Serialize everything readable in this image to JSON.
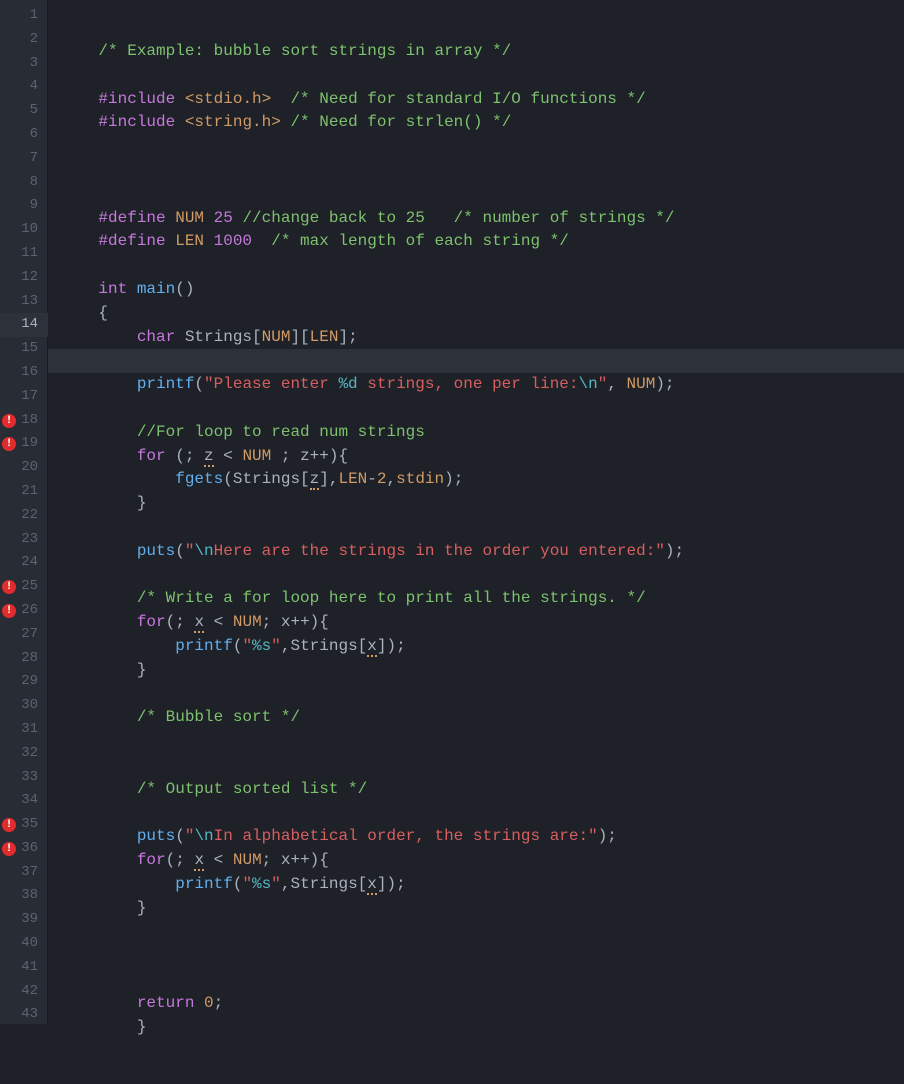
{
  "editor": {
    "currentLine": 14,
    "errorLines": [
      18,
      19,
      25,
      26,
      35,
      36
    ],
    "errorBadge": "!",
    "lines": [
      {
        "n": 1,
        "tokens": [
          [
            "    ",
            ""
          ],
          [
            "/* Example: bubble sort strings in array */",
            "c-comment"
          ]
        ]
      },
      {
        "n": 2,
        "tokens": []
      },
      {
        "n": 3,
        "tokens": [
          [
            "    ",
            ""
          ],
          [
            "#include ",
            "c-preproc"
          ],
          [
            "<stdio.h>",
            "c-include"
          ],
          [
            "  ",
            ""
          ],
          [
            "/* Need for standard I/O functions */",
            "c-comment"
          ]
        ]
      },
      {
        "n": 4,
        "tokens": [
          [
            "    ",
            ""
          ],
          [
            "#include ",
            "c-preproc"
          ],
          [
            "<string.h>",
            "c-include"
          ],
          [
            " ",
            ""
          ],
          [
            "/* Need for strlen() */",
            "c-comment"
          ]
        ]
      },
      {
        "n": 5,
        "tokens": []
      },
      {
        "n": 6,
        "tokens": []
      },
      {
        "n": 7,
        "tokens": []
      },
      {
        "n": 8,
        "tokens": [
          [
            "    ",
            ""
          ],
          [
            "#define ",
            "c-preproc"
          ],
          [
            "NUM ",
            "c-const"
          ],
          [
            "25",
            "c-number"
          ],
          [
            " ",
            ""
          ],
          [
            "//change back to 25   /* number of strings */",
            "c-comment"
          ]
        ]
      },
      {
        "n": 9,
        "tokens": [
          [
            "    ",
            ""
          ],
          [
            "#define ",
            "c-preproc"
          ],
          [
            "LEN ",
            "c-const"
          ],
          [
            "1000",
            "c-number"
          ],
          [
            "  ",
            ""
          ],
          [
            "/* max length of each string */",
            "c-comment"
          ]
        ]
      },
      {
        "n": 10,
        "tokens": []
      },
      {
        "n": 11,
        "tokens": [
          [
            "    ",
            ""
          ],
          [
            "int",
            "c-keyword"
          ],
          [
            " ",
            ""
          ],
          [
            "main",
            "c-func"
          ],
          [
            "()",
            "c-punct"
          ]
        ]
      },
      {
        "n": 12,
        "tokens": [
          [
            "    {",
            "c-punct"
          ]
        ]
      },
      {
        "n": 13,
        "tokens": [
          [
            "        ",
            ""
          ],
          [
            "char",
            "c-keyword"
          ],
          [
            " Strings[",
            ""
          ],
          [
            "NUM",
            "c-const"
          ],
          [
            "][",
            ""
          ],
          [
            "LEN",
            "c-const"
          ],
          [
            "];",
            "c-punct"
          ]
        ]
      },
      {
        "n": 14,
        "tokens": []
      },
      {
        "n": 15,
        "tokens": [
          [
            "        ",
            ""
          ],
          [
            "printf",
            "c-func"
          ],
          [
            "(",
            "c-punct"
          ],
          [
            "\"Please enter ",
            "c-string"
          ],
          [
            "%d",
            "c-escape"
          ],
          [
            " strings, one per line:",
            "c-string"
          ],
          [
            "\\n",
            "c-escape"
          ],
          [
            "\"",
            "c-string"
          ],
          [
            ", ",
            ""
          ],
          [
            "NUM",
            "c-const"
          ],
          [
            ");",
            "c-punct"
          ]
        ]
      },
      {
        "n": 16,
        "tokens": []
      },
      {
        "n": 17,
        "tokens": [
          [
            "        ",
            ""
          ],
          [
            "//For loop to read num strings",
            "c-comment"
          ]
        ]
      },
      {
        "n": 18,
        "tokens": [
          [
            "        ",
            ""
          ],
          [
            "for",
            "c-keyword"
          ],
          [
            " (; ",
            "c-punct"
          ],
          [
            "z",
            "c-warn"
          ],
          [
            " < ",
            ""
          ],
          [
            "NUM",
            "c-const"
          ],
          [
            " ; z++){",
            "c-punct"
          ]
        ]
      },
      {
        "n": 19,
        "tokens": [
          [
            "            ",
            ""
          ],
          [
            "fgets",
            "c-func"
          ],
          [
            "(Strings[",
            "c-punct"
          ],
          [
            "z",
            "c-warn"
          ],
          [
            "],",
            "c-punct"
          ],
          [
            "LEN",
            "c-const"
          ],
          [
            "-",
            "c-punct"
          ],
          [
            "2",
            "c-const"
          ],
          [
            ",",
            "c-punct"
          ],
          [
            "stdin",
            "c-const"
          ],
          [
            ");",
            "c-punct"
          ]
        ]
      },
      {
        "n": 20,
        "tokens": [
          [
            "        }",
            "c-punct"
          ]
        ]
      },
      {
        "n": 21,
        "tokens": []
      },
      {
        "n": 22,
        "tokens": [
          [
            "        ",
            ""
          ],
          [
            "puts",
            "c-func"
          ],
          [
            "(",
            "c-punct"
          ],
          [
            "\"",
            "c-string"
          ],
          [
            "\\n",
            "c-escape"
          ],
          [
            "Here are the strings in the order you entered:\"",
            "c-string"
          ],
          [
            ");",
            "c-punct"
          ]
        ]
      },
      {
        "n": 23,
        "tokens": []
      },
      {
        "n": 24,
        "tokens": [
          [
            "        ",
            ""
          ],
          [
            "/* Write a for loop here to print all the strings. */",
            "c-comment"
          ]
        ]
      },
      {
        "n": 25,
        "tokens": [
          [
            "        ",
            ""
          ],
          [
            "for",
            "c-keyword"
          ],
          [
            "(; ",
            "c-punct"
          ],
          [
            "x",
            "c-warn"
          ],
          [
            " < ",
            ""
          ],
          [
            "NUM",
            "c-const"
          ],
          [
            "; x++){",
            "c-punct"
          ]
        ]
      },
      {
        "n": 26,
        "tokens": [
          [
            "            ",
            ""
          ],
          [
            "printf",
            "c-func"
          ],
          [
            "(",
            "c-punct"
          ],
          [
            "\"",
            "c-string"
          ],
          [
            "%s",
            "c-escape"
          ],
          [
            "\"",
            "c-string"
          ],
          [
            ",Strings[",
            "c-punct"
          ],
          [
            "x",
            "c-warn"
          ],
          [
            "]);",
            "c-punct"
          ]
        ]
      },
      {
        "n": 27,
        "tokens": [
          [
            "        }",
            "c-punct"
          ]
        ]
      },
      {
        "n": 28,
        "tokens": []
      },
      {
        "n": 29,
        "tokens": [
          [
            "        ",
            ""
          ],
          [
            "/* Bubble sort */",
            "c-comment"
          ]
        ]
      },
      {
        "n": 30,
        "tokens": []
      },
      {
        "n": 31,
        "tokens": []
      },
      {
        "n": 32,
        "tokens": [
          [
            "        ",
            ""
          ],
          [
            "/* Output sorted list */",
            "c-comment"
          ]
        ]
      },
      {
        "n": 33,
        "tokens": []
      },
      {
        "n": 34,
        "tokens": [
          [
            "        ",
            ""
          ],
          [
            "puts",
            "c-func"
          ],
          [
            "(",
            "c-punct"
          ],
          [
            "\"",
            "c-string"
          ],
          [
            "\\n",
            "c-escape"
          ],
          [
            "In alphabetical order, the strings are:\"",
            "c-string"
          ],
          [
            ");",
            "c-punct"
          ]
        ]
      },
      {
        "n": 35,
        "tokens": [
          [
            "        ",
            ""
          ],
          [
            "for",
            "c-keyword"
          ],
          [
            "(; ",
            "c-punct"
          ],
          [
            "x",
            "c-warn"
          ],
          [
            " < ",
            ""
          ],
          [
            "NUM",
            "c-const"
          ],
          [
            "; x++){",
            "c-punct"
          ]
        ]
      },
      {
        "n": 36,
        "tokens": [
          [
            "            ",
            ""
          ],
          [
            "printf",
            "c-func"
          ],
          [
            "(",
            "c-punct"
          ],
          [
            "\"",
            "c-string"
          ],
          [
            "%s",
            "c-escape"
          ],
          [
            "\"",
            "c-string"
          ],
          [
            ",Strings[",
            "c-punct"
          ],
          [
            "x",
            "c-warn"
          ],
          [
            "]);",
            "c-punct"
          ]
        ]
      },
      {
        "n": 37,
        "tokens": [
          [
            "        }",
            "c-punct"
          ]
        ]
      },
      {
        "n": 38,
        "tokens": []
      },
      {
        "n": 39,
        "tokens": []
      },
      {
        "n": 40,
        "tokens": []
      },
      {
        "n": 41,
        "tokens": [
          [
            "        ",
            ""
          ],
          [
            "return",
            "c-keyword"
          ],
          [
            " ",
            ""
          ],
          [
            "0",
            "c-const"
          ],
          [
            ";",
            "c-punct"
          ]
        ]
      },
      {
        "n": 42,
        "tokens": [
          [
            "        }",
            "c-punct"
          ]
        ]
      },
      {
        "n": 43,
        "tokens": []
      }
    ]
  }
}
